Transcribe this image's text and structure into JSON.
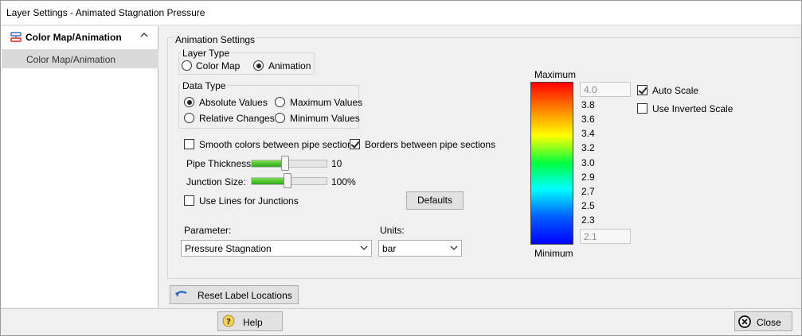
{
  "window": {
    "title": "Layer Settings - Animated Stagnation Pressure"
  },
  "sidebar": {
    "group_label": "Color Map/Animation",
    "items": [
      {
        "label": "Color Map/Animation"
      }
    ]
  },
  "animation_settings": {
    "group_label": "Animation Settings",
    "layer_type": {
      "label": "Layer Type",
      "options": [
        {
          "label": "Color Map",
          "selected": false
        },
        {
          "label": "Animation",
          "selected": true
        }
      ]
    },
    "data_type": {
      "label": "Data Type",
      "options": [
        {
          "label": "Absolute Values",
          "selected": true
        },
        {
          "label": "Maximum Values",
          "selected": false
        },
        {
          "label": "Relative Changes",
          "selected": false
        },
        {
          "label": "Minimum Values",
          "selected": false
        }
      ]
    },
    "smooth_colors": {
      "label": "Smooth colors between pipe sections",
      "checked": false
    },
    "borders": {
      "label": "Borders between pipe sections",
      "checked": true
    },
    "pipe_thickness": {
      "label": "Pipe Thickness:",
      "value": "10",
      "level": 0.45
    },
    "junction_size": {
      "label": "Junction Size:",
      "value": "100%",
      "level": 0.48
    },
    "use_lines": {
      "label": "Use Lines for Junctions",
      "checked": false
    },
    "defaults_label": "Defaults",
    "parameter": {
      "label": "Parameter:",
      "value": "Pressure Stagnation"
    },
    "units": {
      "label": "Units:",
      "value": "bar"
    }
  },
  "color_scale": {
    "max_label": "Maximum",
    "min_label": "Minimum",
    "max_value": "4.0",
    "min_value": "2.1",
    "ticks": [
      "3.8",
      "3.6",
      "3.4",
      "3.2",
      "3.0",
      "2.9",
      "2.7",
      "2.5",
      "2.3"
    ],
    "auto_scale": {
      "label": "Auto Scale",
      "checked": true
    },
    "inverted_scale": {
      "label": "Use Inverted Scale",
      "checked": false
    }
  },
  "buttons": {
    "reset_label_locations": "Reset Label Locations",
    "help": "Help",
    "close": "Close"
  },
  "colors": {
    "accent_blue": "#3b6fc4",
    "selection_gray": "#d9d9d9"
  }
}
